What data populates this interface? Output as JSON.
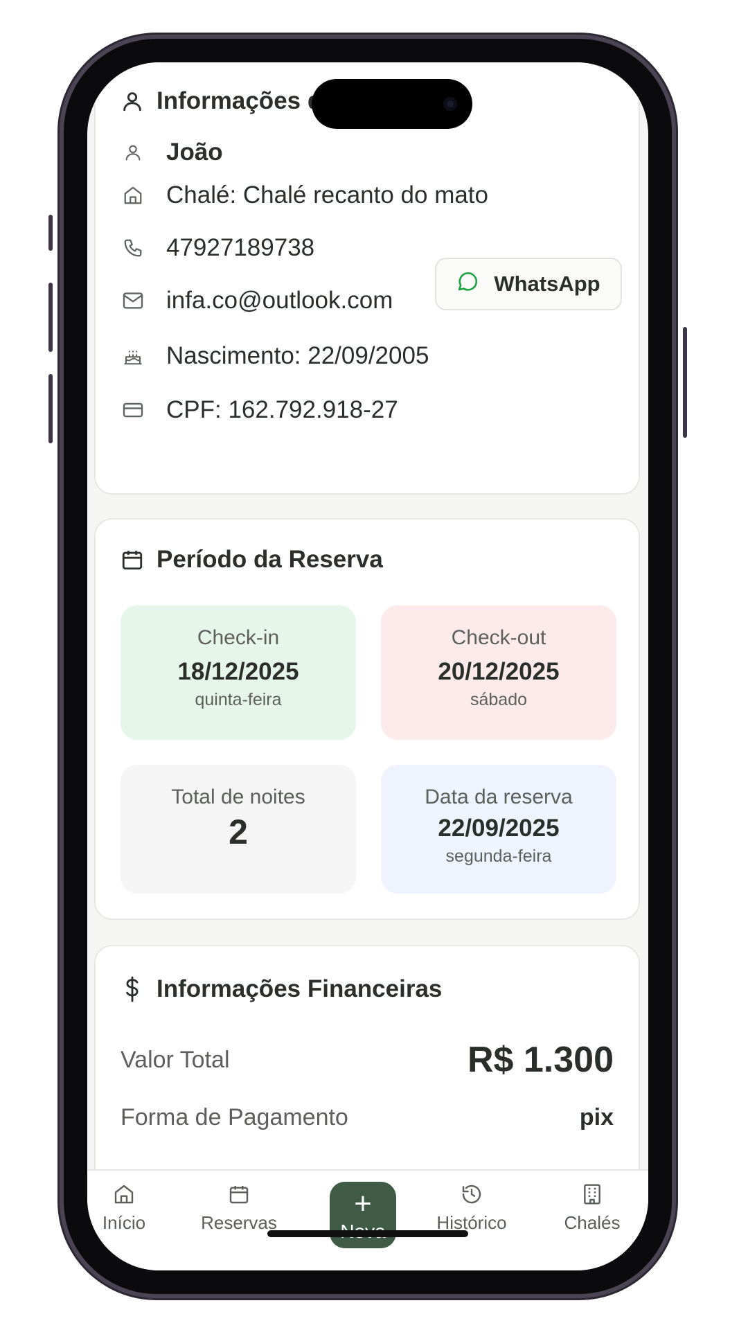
{
  "guest": {
    "title": "Informações do Hóspede",
    "name": "João",
    "chalet": "Chalé: Chalé recanto do mato",
    "phone": "47927189738",
    "whatsapp_label": "WhatsApp",
    "email": "infa.co@outlook.com",
    "birth": "Nascimento: 22/09/2005",
    "cpf": "CPF: 162.792.918-27"
  },
  "period": {
    "title": "Período da Reserva",
    "checkin": {
      "label": "Check-in",
      "date": "18/12/2025",
      "weekday": "quinta-feira"
    },
    "checkout": {
      "label": "Check-out",
      "date": "20/12/2025",
      "weekday": "sábado"
    },
    "nights": {
      "label": "Total de noites",
      "value": "2"
    },
    "booking": {
      "label": "Data da reserva",
      "date": "22/09/2025",
      "weekday": "segunda-feira"
    }
  },
  "finance": {
    "title": "Informações Financeiras",
    "total_label": "Valor Total",
    "total_value": "R$ 1.300",
    "payment_label": "Forma de Pagamento",
    "payment_value": "pix"
  },
  "nav": {
    "home": "Início",
    "reservations": "Reservas",
    "new": "Nova",
    "history": "Histórico",
    "chalets": "Chalés"
  },
  "colors": {
    "checkin_bg": "#e6f6ea",
    "checkout_bg": "#fdebec",
    "nights_bg": "#f5f5f5",
    "booking_bg": "#eef3fd",
    "accent": "#3f5a45",
    "whatsapp": "#22a347"
  }
}
